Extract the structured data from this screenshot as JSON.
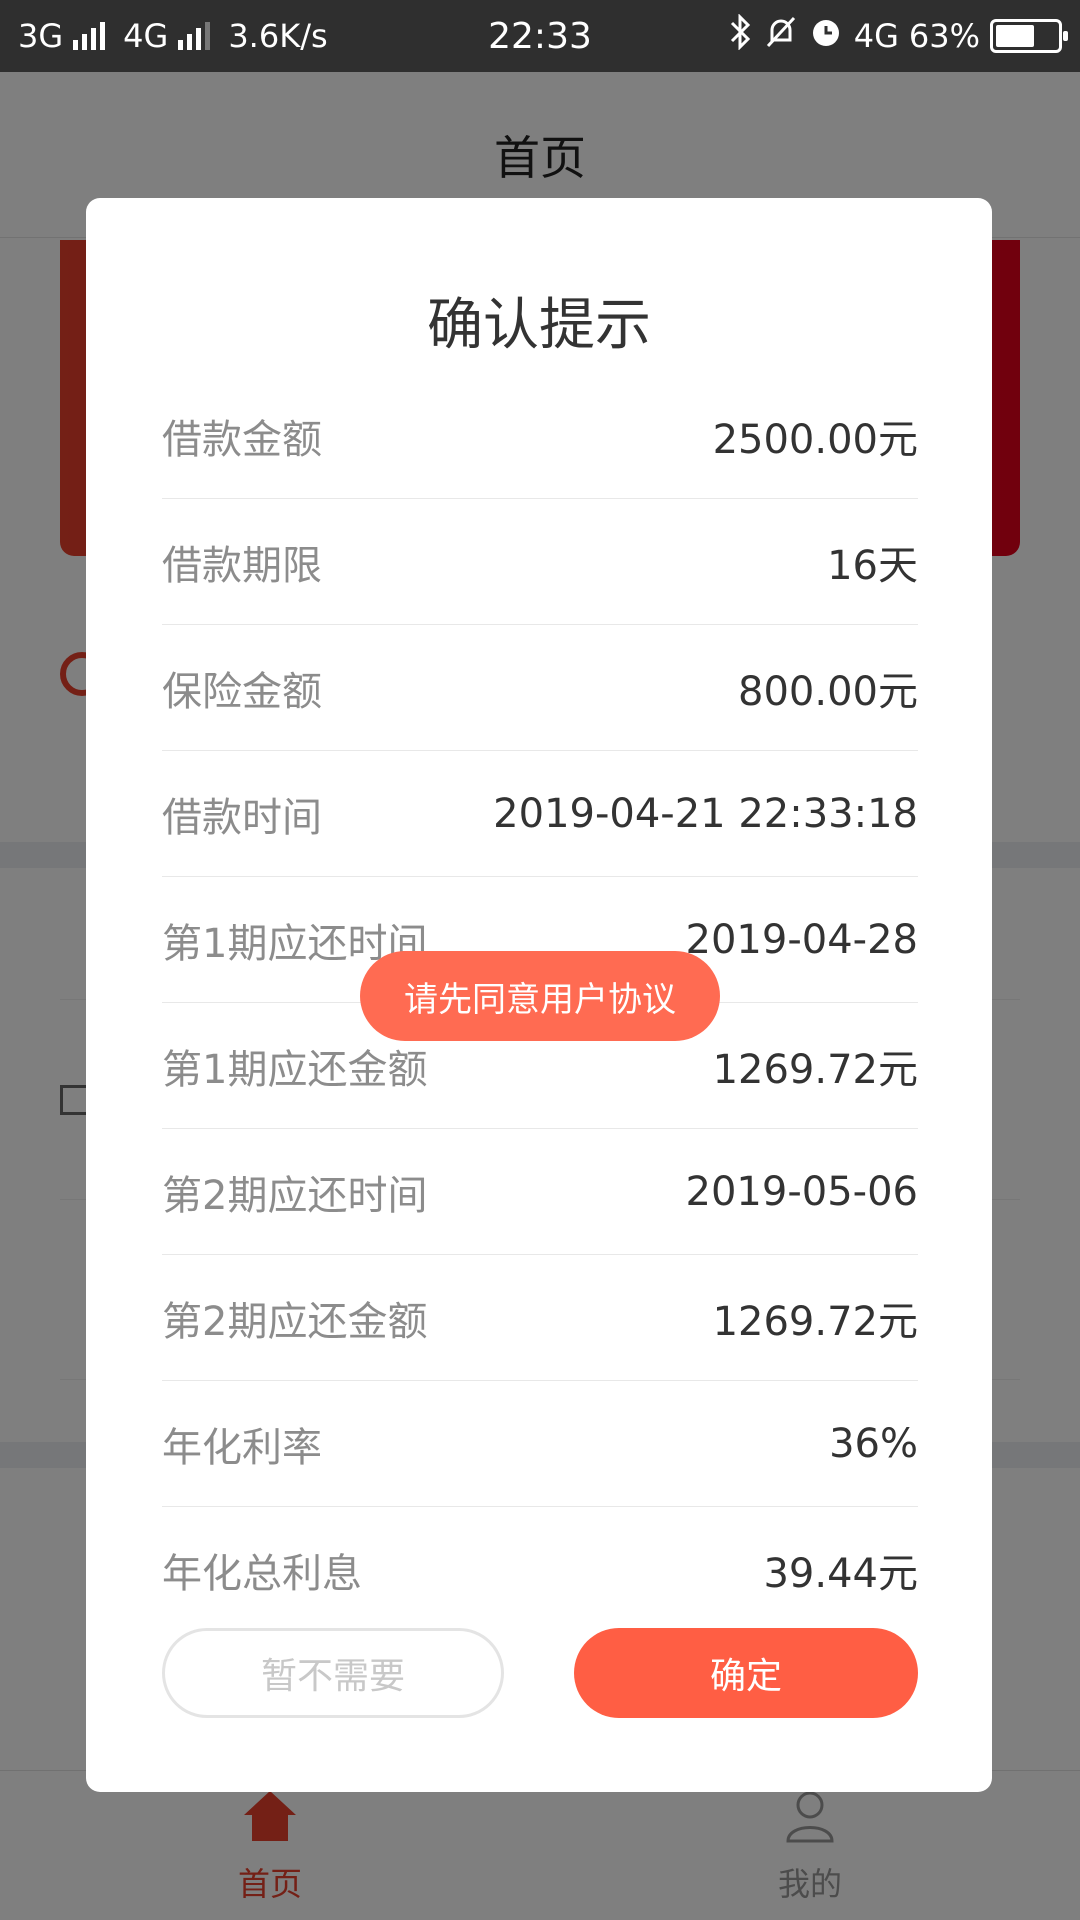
{
  "status_bar": {
    "net1": "3G",
    "net2": "4G",
    "speed": "3.6K/s",
    "time": "22:33",
    "net3": "4G",
    "battery": "63%",
    "battery_level": 0.63,
    "icons": [
      "bluetooth-icon",
      "mute-icon",
      "alarm-icon"
    ]
  },
  "app": {
    "title": "首页",
    "tabs": [
      {
        "label": "首页",
        "icon": "home-icon",
        "active": true
      },
      {
        "label": "我的",
        "icon": "person-icon",
        "active": false
      }
    ]
  },
  "modal": {
    "title": "确认提示",
    "rows": [
      {
        "label": "借款金额",
        "value": "2500.00元"
      },
      {
        "label": "借款期限",
        "value": "16天"
      },
      {
        "label": "保险金额",
        "value": "800.00元"
      },
      {
        "label": "借款时间",
        "value": "2019-04-21 22:33:18"
      },
      {
        "label": "第1期应还时间",
        "value": "2019-04-28"
      },
      {
        "label": "第1期应还金额",
        "value": "1269.72元"
      },
      {
        "label": "第2期应还时间",
        "value": "2019-05-06"
      },
      {
        "label": "第2期应还金额",
        "value": "1269.72元"
      },
      {
        "label": "年化利率",
        "value": "36%"
      },
      {
        "label": "年化总利息",
        "value": "39.44元"
      }
    ],
    "cancel_label": "暂不需要",
    "confirm_label": "确定"
  },
  "toast": "请先同意用户协议",
  "colors": {
    "accent": "#ff5e44",
    "brand_red": "#e2001b",
    "overlay": "rgba(0,0,0,0.5)"
  }
}
